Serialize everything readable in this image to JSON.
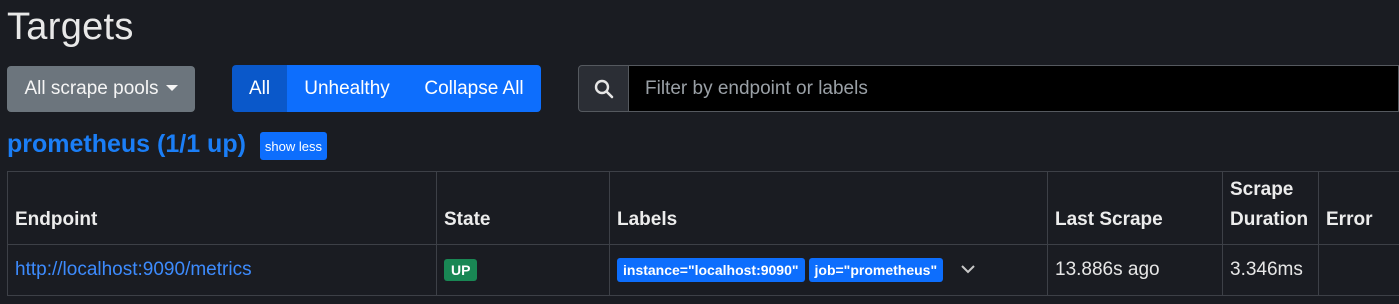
{
  "page": {
    "title": "Targets"
  },
  "toolbar": {
    "scrape_pools_label": "All scrape pools",
    "filter_all_label": "All",
    "filter_unhealthy_label": "Unhealthy",
    "collapse_all_label": "Collapse All",
    "search_icon": "search-icon",
    "search_placeholder": "Filter by endpoint or labels",
    "search_value": ""
  },
  "pool": {
    "title": "prometheus (1/1 up)",
    "toggle_label": "show less",
    "columns": [
      "Endpoint",
      "State",
      "Labels",
      "Last Scrape",
      "Scrape Duration",
      "Error"
    ],
    "rows": [
      {
        "endpoint": "http://localhost:9090/metrics",
        "state": "UP",
        "labels": [
          "instance=\"localhost:9090\"",
          "job=\"prometheus\""
        ],
        "last_scrape": "13.886s ago",
        "scrape_duration": "3.346ms",
        "error": ""
      }
    ]
  },
  "colors": {
    "background": "#1a1c22",
    "primary": "#0d6efd",
    "link": "#3d8bfd",
    "success": "#198754",
    "secondary": "#6c757d"
  }
}
